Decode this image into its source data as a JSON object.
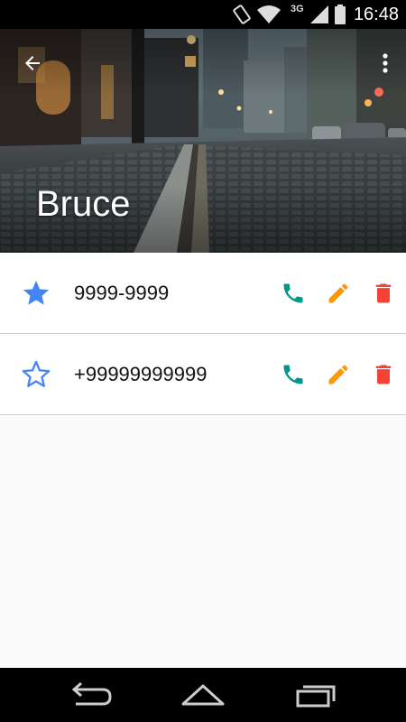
{
  "status_bar": {
    "time": "16:48",
    "network_type": "3G",
    "icons": [
      "rotate-icon",
      "wifi-icon",
      "signal-icon",
      "battery-icon"
    ]
  },
  "header": {
    "contact_name": "Bruce",
    "back_icon": "arrow-back-icon",
    "menu_icon": "more-vert-icon"
  },
  "phones": [
    {
      "number": "9999-9999",
      "favorite": true
    },
    {
      "number": "+99999999999",
      "favorite": false
    }
  ],
  "colors": {
    "star": "#4285f4",
    "call": "#009688",
    "edit": "#ff9800",
    "delete": "#f44336"
  },
  "nav_bar": {
    "icons": [
      "back-nav-icon",
      "home-nav-icon",
      "recents-nav-icon"
    ]
  }
}
